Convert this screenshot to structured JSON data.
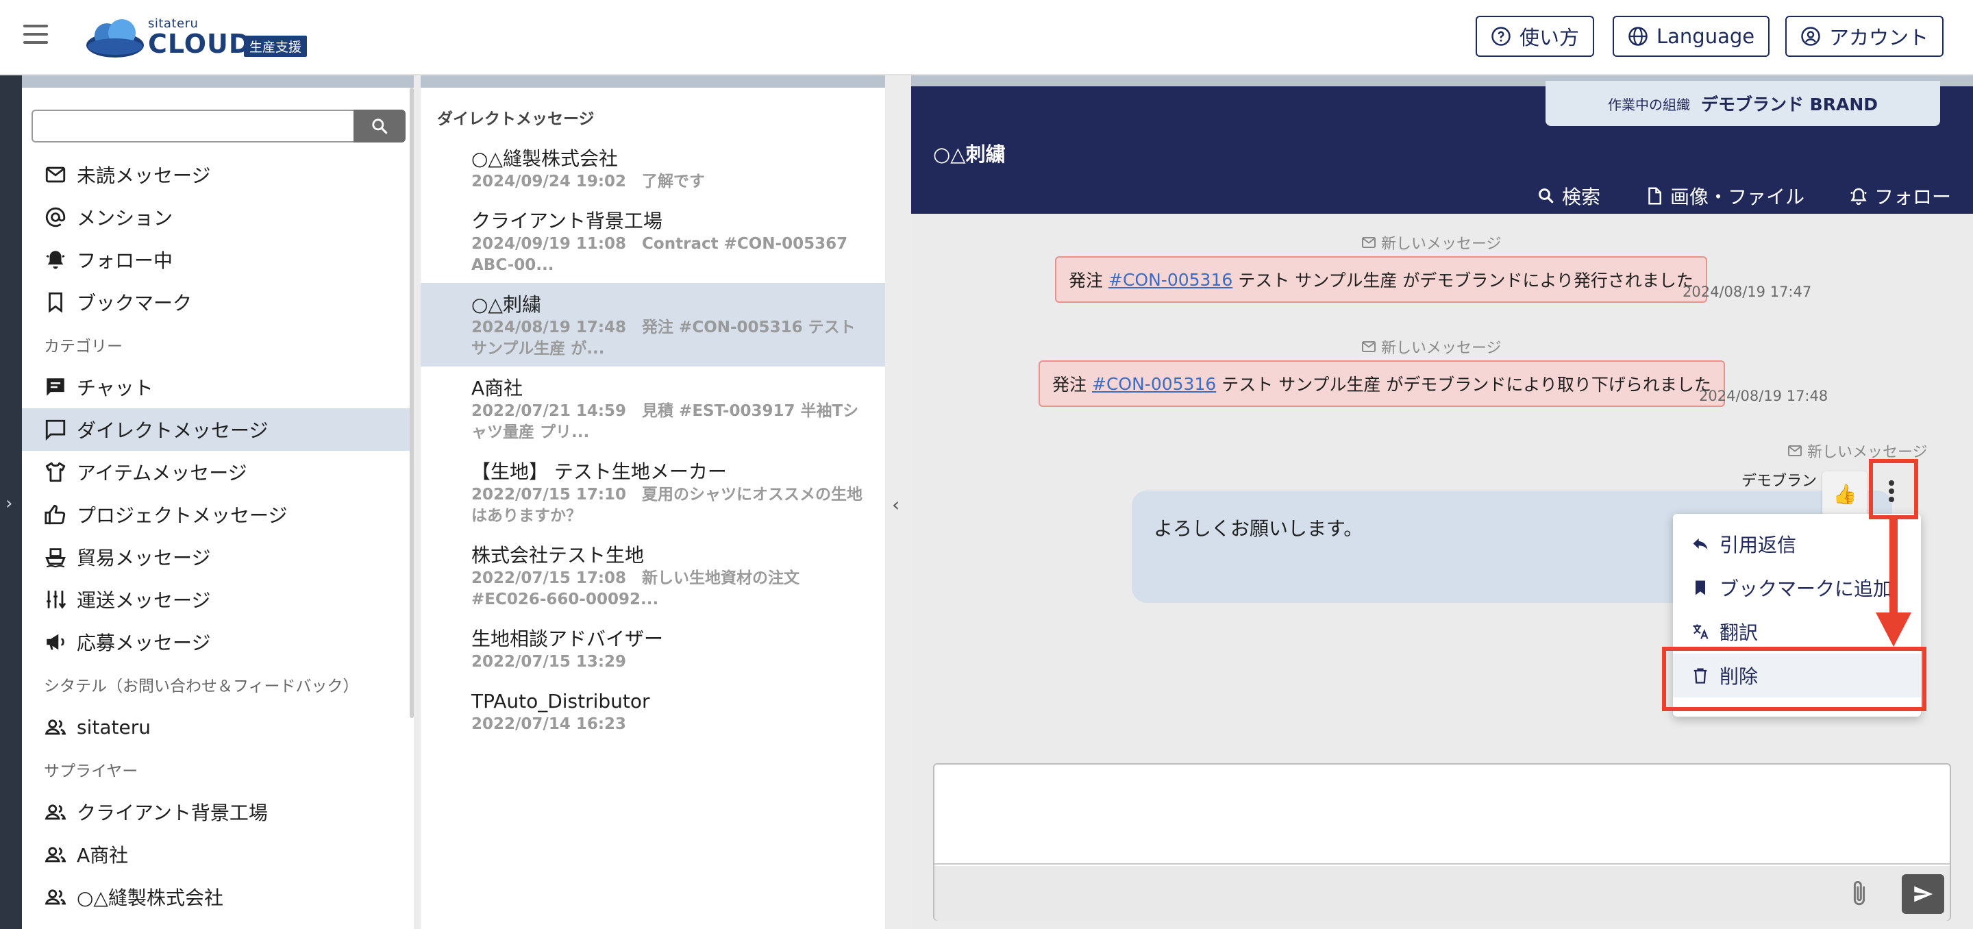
{
  "header": {
    "logo_small": "sitateru",
    "logo_main": "CLOUD",
    "logo_badge": "生産支援",
    "buttons": {
      "help": "使い方",
      "language": "Language",
      "account": "アカウント"
    }
  },
  "sidebar": {
    "search": {
      "placeholder": "",
      "value": ""
    },
    "items": [
      {
        "label": "未読メッセージ",
        "icon": "mail-icon"
      },
      {
        "label": "メンション",
        "icon": "at-icon"
      },
      {
        "label": "フォロー中",
        "icon": "bell-icon"
      },
      {
        "label": "ブックマーク",
        "icon": "bookmark-icon"
      }
    ],
    "heading_category": "カテゴリー",
    "category_items": [
      {
        "label": "チャット",
        "icon": "chat-icon"
      },
      {
        "label": "ダイレクトメッセージ",
        "icon": "message-icon",
        "active": true
      },
      {
        "label": "アイテムメッセージ",
        "icon": "shirt-icon"
      },
      {
        "label": "プロジェクトメッセージ",
        "icon": "thumb-icon"
      },
      {
        "label": "貿易メッセージ",
        "icon": "ship-icon"
      },
      {
        "label": "運送メッセージ",
        "icon": "sort-icon"
      },
      {
        "label": "応募メッセージ",
        "icon": "megaphone-icon"
      }
    ],
    "heading_sitateru": "シタテル（お問い合わせ＆フィードバック）",
    "sitateru_items": [
      {
        "label": "sitateru",
        "icon": "people-icon"
      }
    ],
    "heading_supplier": "サプライヤー",
    "supplier_items": [
      {
        "label": "クライアント背景工場",
        "icon": "people-icon"
      },
      {
        "label": "A商社",
        "icon": "people-icon"
      },
      {
        "label": "○△縫製株式会社",
        "icon": "people-icon"
      }
    ]
  },
  "conversations": {
    "title": "ダイレクトメッセージ",
    "items": [
      {
        "name": "○△縫製株式会社",
        "meta": "2024/09/24 19:02　了解です"
      },
      {
        "name": "クライアント背景工場",
        "meta": "2024/09/19 11:08　Contract #CON-005367 ABC-00..."
      },
      {
        "name": "○△刺繍",
        "meta": "2024/08/19 17:48　発注 #CON-005316 テスト サンプル生産 が...",
        "active": true
      },
      {
        "name": "A商社",
        "meta": "2022/07/21 14:59　見積 #EST-003917 半袖Tシャツ量産 プリ..."
      },
      {
        "name": "【生地】 テスト生地メーカー",
        "meta": "2022/07/15 17:10　夏用のシャツにオススメの生地はありますか？"
      },
      {
        "name": "株式会社テスト生地",
        "meta": "2022/07/15 17:08　新しい生地資材の注文 #EC026-660-00092..."
      },
      {
        "name": "生地相談アドバイザー",
        "meta": "2022/07/15 13:29"
      },
      {
        "name": "TPAuto_Distributor",
        "meta": "2022/07/14 16:23"
      }
    ]
  },
  "chat": {
    "org_label": "作業中の組織",
    "org_name": "デモブランド BRAND",
    "title": "○△刺繍",
    "tools": {
      "search": "検索",
      "files": "画像・ファイル",
      "follow": "フォロー"
    },
    "new_message_label": "新しいメッセージ",
    "system_messages": [
      {
        "prefix": "発注",
        "link": "#CON-005316",
        "suffix": "テスト サンプル生産 がデモブランドにより発行されました",
        "time": "2024/08/19 17:47"
      },
      {
        "prefix": "発注",
        "link": "#CON-005316",
        "suffix": "テスト サンプル生産 がデモブランドにより取り下げられました",
        "time": "2024/08/19 17:48"
      }
    ],
    "message": {
      "sender": "デモブラン",
      "text": "よろしくお願いします。",
      "reaction": "👍"
    },
    "context_menu": [
      {
        "label": "引用返信",
        "icon": "reply-icon"
      },
      {
        "label": "ブックマークに追加",
        "icon": "bookmark-filled-icon"
      },
      {
        "label": "翻訳",
        "icon": "translate-icon"
      },
      {
        "label": "削除",
        "icon": "trash-icon",
        "highlighted": true
      }
    ],
    "compose": {
      "placeholder": "",
      "value": ""
    }
  },
  "colors": {
    "navy": "#21295b",
    "active_bg": "#d7e0ea",
    "alert_bg": "#f6d6d4",
    "alert_border": "#e6938d",
    "annotation_red": "#e8412e"
  }
}
